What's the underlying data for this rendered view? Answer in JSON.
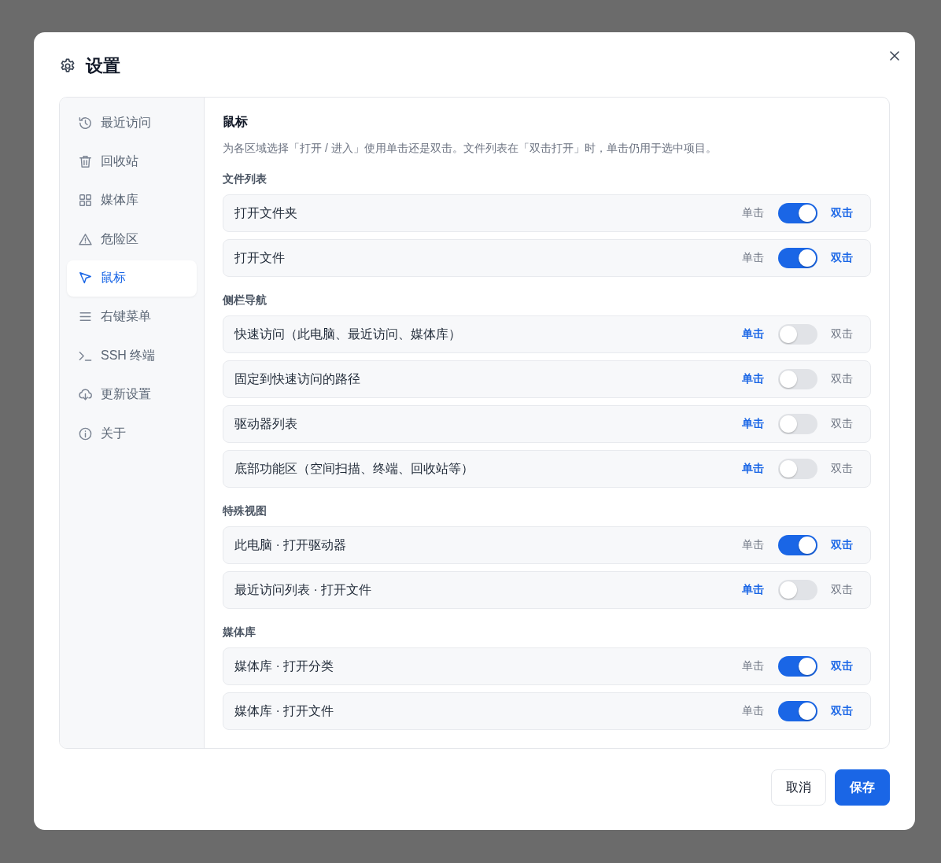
{
  "dialog": {
    "title": "设置"
  },
  "sidebar": {
    "items": [
      {
        "label": "最近访问",
        "selected": false
      },
      {
        "label": "回收站",
        "selected": false
      },
      {
        "label": "媒体库",
        "selected": false
      },
      {
        "label": "危险区",
        "selected": false
      },
      {
        "label": "鼠标",
        "selected": true
      },
      {
        "label": "右键菜单",
        "selected": false
      },
      {
        "label": "SSH 终端",
        "selected": false
      },
      {
        "label": "更新设置",
        "selected": false
      },
      {
        "label": "关于",
        "selected": false
      }
    ]
  },
  "panel": {
    "title": "鼠标",
    "description": "为各区域选择「打开 / 进入」使用单击还是双击。文件列表在「双击打开」时，单击仍用于选中项目。",
    "sections": [
      {
        "heading": "文件列表",
        "rows": [
          {
            "label": "打开文件夹",
            "single": "单击",
            "double": "双击",
            "on": true
          },
          {
            "label": "打开文件",
            "single": "单击",
            "double": "双击",
            "on": true
          }
        ]
      },
      {
        "heading": "侧栏导航",
        "rows": [
          {
            "label": "快速访问（此电脑、最近访问、媒体库）",
            "single": "单击",
            "double": "双击",
            "on": false
          },
          {
            "label": "固定到快速访问的路径",
            "single": "单击",
            "double": "双击",
            "on": false
          },
          {
            "label": "驱动器列表",
            "single": "单击",
            "double": "双击",
            "on": false
          },
          {
            "label": "底部功能区（空间扫描、终端、回收站等）",
            "single": "单击",
            "double": "双击",
            "on": false
          }
        ]
      },
      {
        "heading": "特殊视图",
        "rows": [
          {
            "label": "此电脑 · 打开驱动器",
            "single": "单击",
            "double": "双击",
            "on": true
          },
          {
            "label": "最近访问列表 · 打开文件",
            "single": "单击",
            "double": "双击",
            "on": false
          }
        ]
      },
      {
        "heading": "媒体库",
        "rows": [
          {
            "label": "媒体库 · 打开分类",
            "single": "单击",
            "double": "双击",
            "on": true
          },
          {
            "label": "媒体库 · 打开文件",
            "single": "单击",
            "double": "双击",
            "on": true
          }
        ]
      }
    ]
  },
  "buttons": [
    {
      "label": "取消",
      "kind": "secondary"
    },
    {
      "label": "保存",
      "kind": "primary"
    }
  ]
}
